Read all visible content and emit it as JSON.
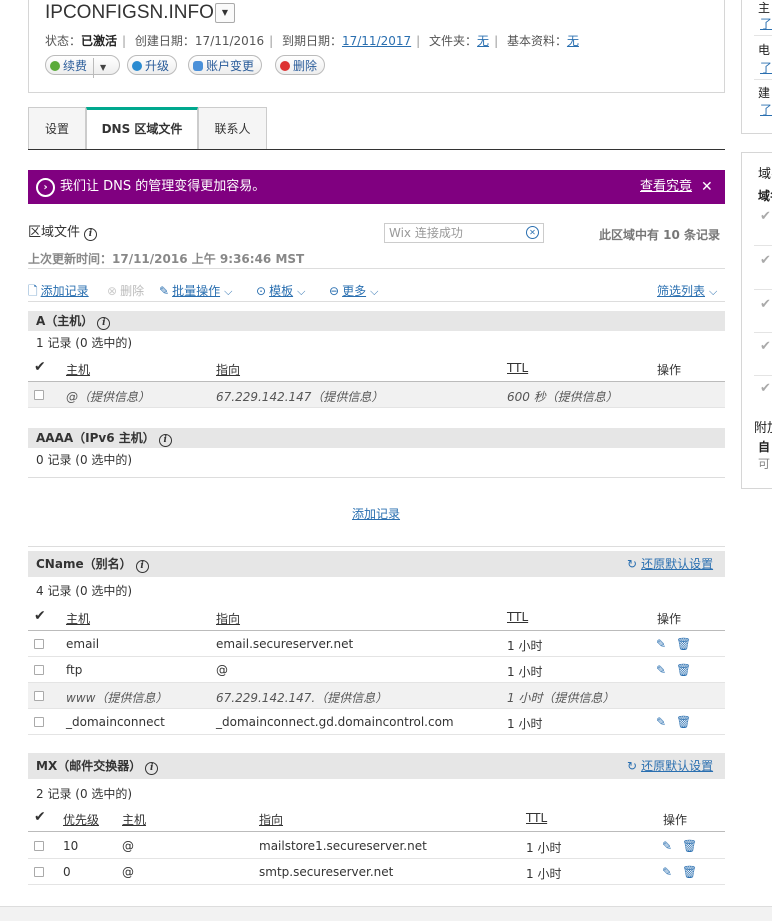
{
  "domain": {
    "name": "IPCONFIGSN.INFO",
    "status_label": "状态：",
    "status_value": "已激活",
    "created_label": "创建日期：",
    "created_value": "17/11/2016",
    "expires_label": "到期日期：",
    "expires_value": "17/11/2017",
    "folder_label": "文件夹：",
    "folder_value": "无",
    "profile_label": "基本资料：",
    "profile_value": "无",
    "buttons": {
      "renew": "续费",
      "upgrade": "升级",
      "account_change": "账户变更",
      "delete": "删除"
    }
  },
  "sidebar": {
    "top": [
      {
        "label": "主",
        "link": "了"
      },
      {
        "label": "电",
        "link": "了"
      },
      {
        "label": "建",
        "link": "了"
      }
    ],
    "panel_title": "域名",
    "panel_sub": "域名",
    "addon_title": "附加",
    "addon_sub": "自",
    "addon_note": "可"
  },
  "tabs": [
    {
      "label": "设置",
      "active": false
    },
    {
      "label": "DNS 区域文件",
      "active": true
    },
    {
      "label": "联系人",
      "active": false
    }
  ],
  "banner": {
    "message": "我们让 DNS 的管理变得更加容易。",
    "link": "查看究竟",
    "close": "✕",
    "color": "#800080"
  },
  "zone": {
    "title": "区域文件",
    "search_placeholder": "Wix 连接成功",
    "record_count": "此区域中有 10 条记录",
    "last_updated": "上次更新时间：17/11/2016 上午 9:36:46 MST"
  },
  "toolbar": {
    "add": "添加记录",
    "delete": "删除",
    "bulk": "批量操作",
    "template": "模板",
    "more": "更多",
    "filter": "筛选列表"
  },
  "headers": {
    "host": "主机",
    "points_to": "指向",
    "ttl": "TTL",
    "actions": "操作",
    "priority": "优先级"
  },
  "sections": {
    "a": {
      "title": "A（主机）",
      "count": "1 记录 (0 选中的)",
      "rows": [
        {
          "host": "@（提供信息）",
          "points_to": "67.229.142.147（提供信息）",
          "ttl": "600 秒（提供信息）"
        }
      ]
    },
    "aaaa": {
      "title": "AAAA（IPv6 主机）",
      "count": "0 记录 (0 选中的)",
      "add_link": "添加记录"
    },
    "cname": {
      "title": "CName（别名）",
      "count": "4 记录 (0 选中的)",
      "restore": "还原默认设置",
      "rows": [
        {
          "host": "email",
          "points_to": "email.secureserver.net",
          "ttl": "1 小时"
        },
        {
          "host": "ftp",
          "points_to": "@",
          "ttl": "1 小时"
        },
        {
          "host": "www（提供信息）",
          "points_to": "67.229.142.147.（提供信息）",
          "ttl": "1 小时（提供信息）"
        },
        {
          "host": "_domainconnect",
          "points_to": "_domainconnect.gd.domaincontrol.com",
          "ttl": "1 小时"
        }
      ]
    },
    "mx": {
      "title": "MX（邮件交换器）",
      "count": "2 记录 (0 选中的)",
      "restore": "还原默认设置",
      "rows": [
        {
          "priority": "10",
          "host": "@",
          "points_to": "mailstore1.secureserver.net",
          "ttl": "1 小时"
        },
        {
          "priority": "0",
          "host": "@",
          "points_to": "smtp.secureserver.net",
          "ttl": "1 小时"
        }
      ]
    }
  },
  "icons": {
    "edit": "edit-icon",
    "trash": "trash-icon",
    "info": "info-icon",
    "checkmark": "checkmark-icon"
  }
}
